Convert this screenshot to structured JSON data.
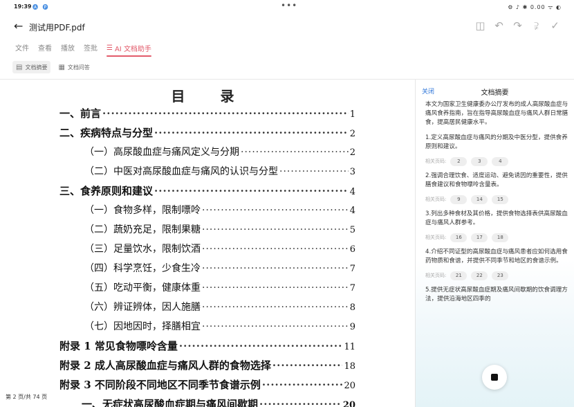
{
  "status_bar": {
    "time": "19:39",
    "app_icons": "🅐 🅟",
    "center_dots": "•••",
    "right_indicators": "⚙ ♪ ✱ 0.00 ᯤ ◐"
  },
  "header": {
    "back_icon": "arrow-left-icon",
    "title": "测试用PDF.pdf",
    "toolbar_icons": [
      "layout-icon",
      "undo-icon",
      "redo-icon",
      "share-icon",
      "check-icon"
    ]
  },
  "menu": {
    "items": [
      "文件",
      "查看",
      "播放",
      "签批"
    ],
    "ai_label": "AI 文档助手"
  },
  "subtoolbar": {
    "summary_label": "文档摘要",
    "qa_label": "文档问答"
  },
  "document": {
    "toc_title": "目 录",
    "entries": [
      {
        "label": "一、前言",
        "page": "1"
      },
      {
        "label": "二、疾病特点与分型",
        "page": "2"
      },
      {
        "label": "（一）高尿酸血症与痛风定义与分期",
        "page": "2"
      },
      {
        "label": "（二）中医对高尿酸血症与痛风的认识与分型",
        "page": "3"
      },
      {
        "label": "三、食养原则和建议",
        "page": "4"
      },
      {
        "label": "（一）食物多样，限制嘌呤",
        "page": "4"
      },
      {
        "label": "（二）蔬奶充足，限制果糖",
        "page": "5"
      },
      {
        "label": "（三）足量饮水，限制饮酒",
        "page": "6"
      },
      {
        "label": "（四）科学烹饪，少食生冷",
        "page": "7"
      },
      {
        "label": "（五）吃动平衡，健康体重",
        "page": "7"
      },
      {
        "label": "（六）辨证辨体，因人施膳",
        "page": "8"
      },
      {
        "label": "（七）因地因时，择膳相宜",
        "page": "9"
      },
      {
        "label": "附录 1 常见食物嘌呤含量",
        "page": "11"
      },
      {
        "label": "附录 2 成人高尿酸血症与痛风人群的食物选择",
        "page": "18"
      },
      {
        "label": "附录 3 不同阶段不同地区不同季节食谱示例",
        "page": "20"
      },
      {
        "label": "一、无症状高尿酸血症期与痛风间歇期",
        "page": "20"
      }
    ],
    "page_indicator": "第 2 页/共 74 页"
  },
  "summary_panel": {
    "close_label": "关闭",
    "title": "文档摘要",
    "intro": "本文为国家卫生健康委办公厅发布的成人高尿酸血症与痛风食养指南，旨在指导高尿酸血症与痛风人群日常膳食，提高居民健康水平。",
    "related_label": "相关页码:",
    "items": [
      {
        "text": "1.定义高尿酸血症与痛风的分期及中医分型，提供食养原则和建议。",
        "pages": [
          "2",
          "3",
          "4"
        ]
      },
      {
        "text": "2.强调合理饮食、适度运动、避免诱因的重要性，提供膳食建议和食物嘌呤含量表。",
        "pages": [
          "9",
          "14",
          "15"
        ]
      },
      {
        "text": "3.列出多种食材及其价格，提供食物选择表供高尿酸血症与痛风人群参考。",
        "pages": [
          "16",
          "17",
          "18"
        ]
      },
      {
        "text": "4.介绍不同证型的高尿酸血症与痛风患者应如何选用食药物质和食谱，并提供不同季节和地区的食谱示例。",
        "pages": [
          "21",
          "22",
          "23"
        ]
      },
      {
        "text": "5.提供无症状高尿酸血症期及痛风间歇期的饮食调理方法，提供沿海地区四季的",
        "pages": []
      }
    ],
    "stop_icon": "stop-icon"
  }
}
